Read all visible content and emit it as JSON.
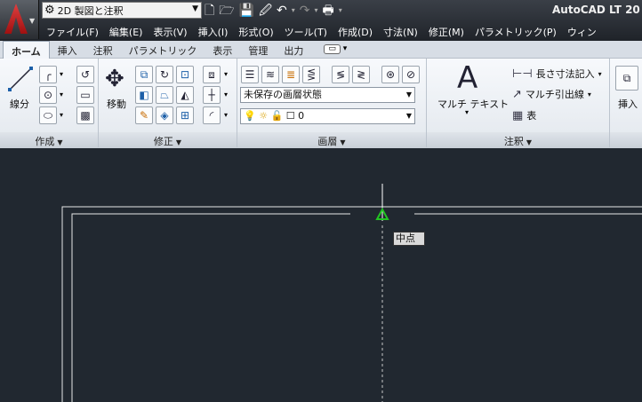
{
  "titlebar": {
    "workspace": "2D 製図と注釈",
    "app_title": "AutoCAD LT 20",
    "qat_icons": [
      "new-icon",
      "open-icon",
      "save-icon",
      "saveas-icon",
      "undo-icon",
      "redo-icon",
      "plot-icon"
    ]
  },
  "menu": [
    "ファイル(F)",
    "編集(E)",
    "表示(V)",
    "挿入(I)",
    "形式(O)",
    "ツール(T)",
    "作成(D)",
    "寸法(N)",
    "修正(M)",
    "パラメトリック(P)",
    "ウィン"
  ],
  "tabs": [
    "ホーム",
    "挿入",
    "注釈",
    "パラメトリック",
    "表示",
    "管理",
    "出力"
  ],
  "panels": {
    "create": {
      "title": "作成",
      "line_label": "線分"
    },
    "modify": {
      "title": "修正",
      "move_label": "移動"
    },
    "layer": {
      "title": "画層",
      "state_value": "未保存の画層状態",
      "layer_value": "0"
    },
    "annotation": {
      "title": "注釈",
      "mtext_label": "マルチ テキスト",
      "dim_label": "長さ寸法記入",
      "leader_label": "マルチ引出線",
      "table_label": "表"
    },
    "insert": {
      "label": "挿入"
    }
  },
  "canvas": {
    "snap_tooltip": "中点"
  },
  "colors": {
    "canvas_bg": "#212830",
    "snap_marker": "#22c422",
    "tab_active": "#f3f6fa"
  }
}
